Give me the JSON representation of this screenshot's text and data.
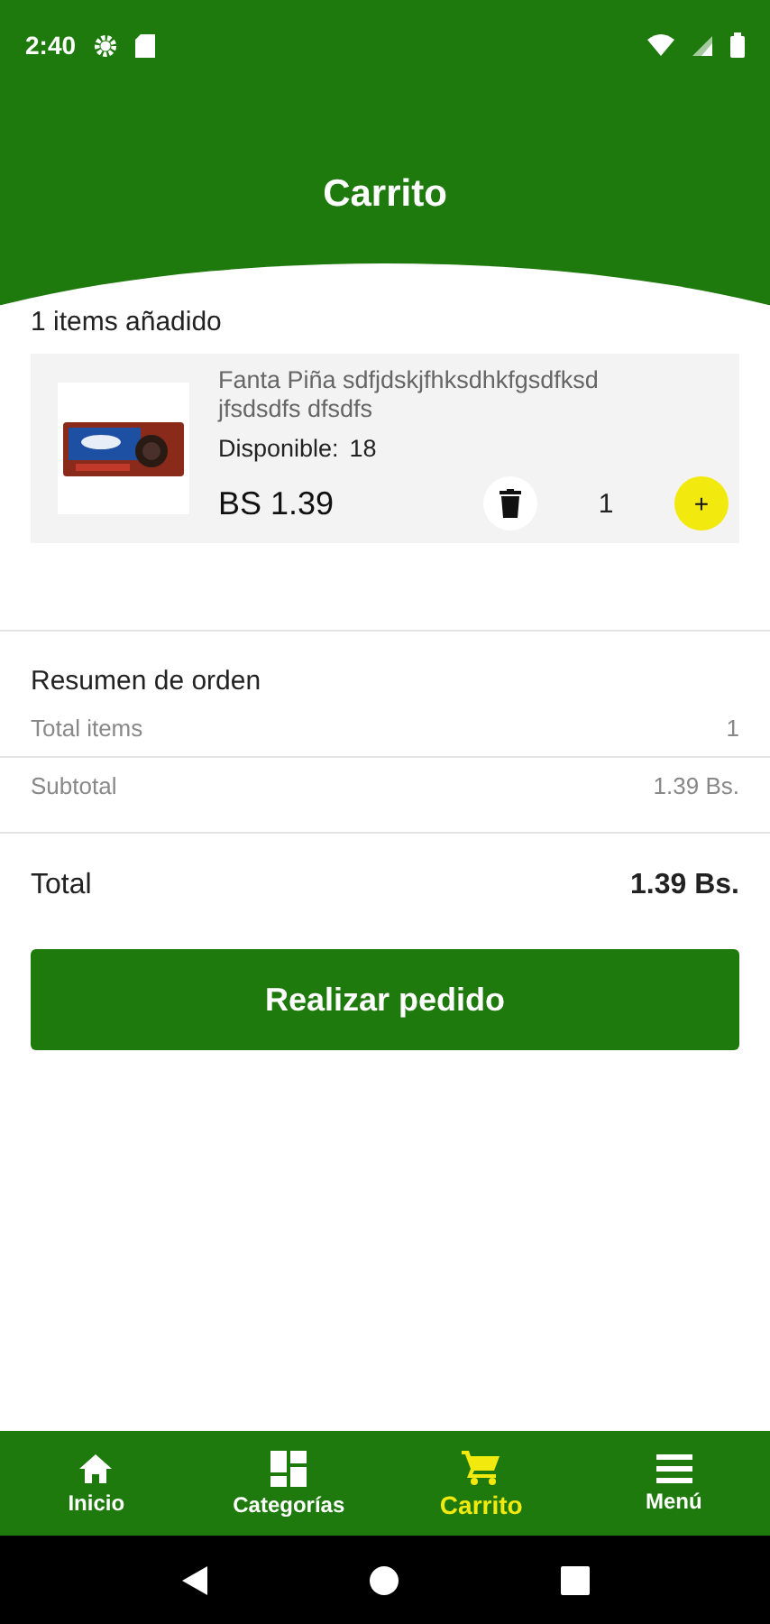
{
  "status_bar": {
    "time": "2:40"
  },
  "header": {
    "title": "Carrito"
  },
  "cart": {
    "count_label": "1 items añadido",
    "items": [
      {
        "kind": "picture",
        "name": "Fanta Piña sdfjdskjfhksdhkfgsdfksd jfsdsdfs dfsdfs",
        "stock_label": "Disponible:",
        "stock": "18",
        "price": "BS 1.39",
        "quantity": "1",
        "add": "+"
      }
    ]
  },
  "summary": {
    "title": "Resumen de orden",
    "rows": [
      {
        "label": "Total items",
        "value": "1"
      },
      {
        "label": "Subtotal",
        "value": "1.39 Bs."
      }
    ],
    "total": {
      "label": "Total",
      "value": "1.39 Bs."
    }
  },
  "order_button": "Realizar pedido",
  "bottom_nav": [
    {
      "kind": "home",
      "label": "Inicio",
      "selected": false
    },
    {
      "kind": "grid",
      "label": "Categorías",
      "selected": false
    },
    {
      "kind": "cart",
      "label": "Carrito",
      "selected": true
    },
    {
      "kind": "menu",
      "label": "Menú",
      "selected": false
    }
  ]
}
